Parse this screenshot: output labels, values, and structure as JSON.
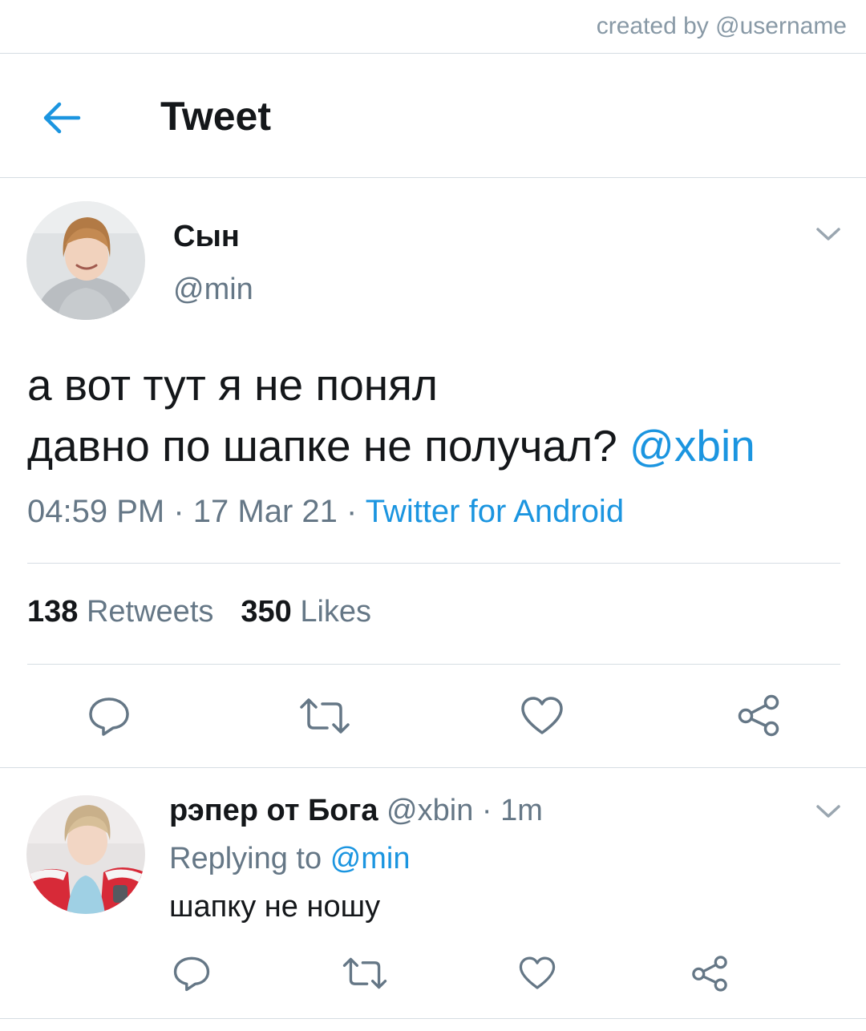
{
  "credit": "created by @username",
  "header": {
    "title": "Tweet"
  },
  "tweet": {
    "author_name": "Сын",
    "author_handle": "@min",
    "text_line1": "а вот тут я не понял",
    "text_line2": "давно по шапке не получал?",
    "mention": "@xbin",
    "time": "04:59 PM",
    "date": "17 Mar 21",
    "source": "Twitter for Android",
    "retweets_count": "138",
    "retweets_label": "Retweets",
    "likes_count": "350",
    "likes_label": "Likes"
  },
  "reply": {
    "author_name": "рэпер от Бога",
    "author_handle": "@xbin",
    "time_ago": "1m",
    "replying_to_label": "Replying to",
    "replying_to_handle": "@min",
    "text": "шапку не ношу"
  },
  "icons": {
    "back": "back-arrow-icon",
    "chevron": "chevron-down-icon",
    "reply": "reply-icon",
    "retweet": "retweet-icon",
    "like": "heart-icon",
    "share": "share-icon"
  },
  "colors": {
    "accent": "#1b95e0",
    "text": "#14171a",
    "muted": "#657786",
    "divider": "#d6dde3"
  }
}
